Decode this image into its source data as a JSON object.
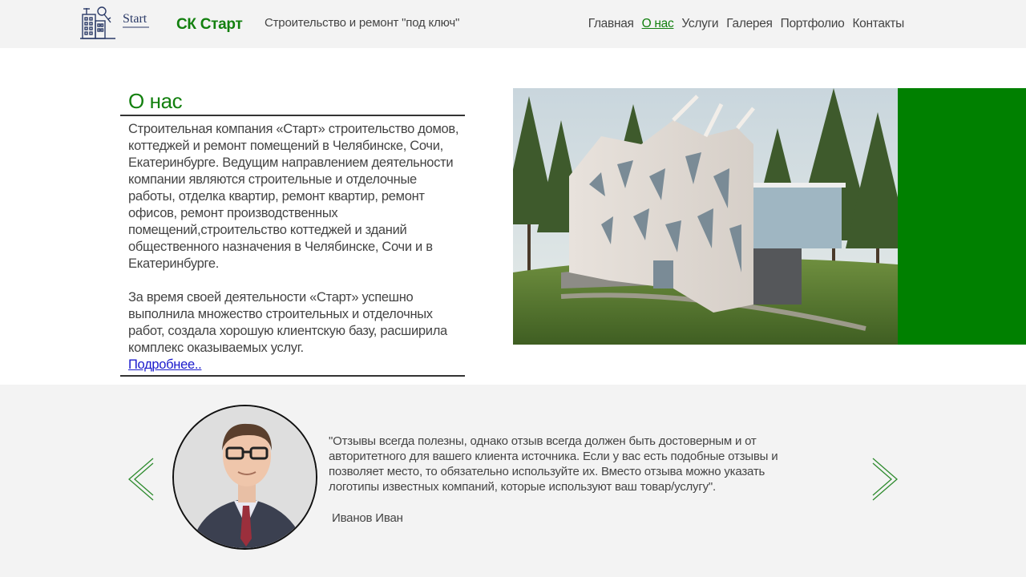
{
  "header": {
    "brand": "СК Старт",
    "tagline": "Строительство и ремонт \"под ключ\"",
    "logo_text": "Start",
    "nav": [
      {
        "label": "Главная",
        "active": false
      },
      {
        "label": "О нас",
        "active": true
      },
      {
        "label": "Услуги",
        "active": false
      },
      {
        "label": "Галерея",
        "active": false
      },
      {
        "label": "Портфолио",
        "active": false
      },
      {
        "label": "Контакты",
        "active": false
      }
    ]
  },
  "about": {
    "title": "О нас",
    "paragraph1": "Строительная компания «Старт» строительство домов, коттеджей и ремонт помещений в Челябинске, Сочи, Екатеринбурге. Ведущим направлением деятельности компании являются строительные и отделочные работы, отделка квартир, ремонт квартир, ремонт офисов, ремонт производственных помещений,строительство коттеджей и зданий общественного назначения в Челябинске, Сочи и в Екатеринбурге.",
    "paragraph2": "За время своей деятельности «Старт» успешно выполнила множество строительных и отделочных работ, создала хорошую клиентскую базу, расширила комплекс оказываемых услуг.",
    "more_link": "Подробнее.."
  },
  "review": {
    "quote": "\"Отзывы всегда полезны, однако отзыв всегда должен быть достоверным и от авторитетного для вашего клиента источника. Если у вас есть подобные отзывы и позволяет место, то обязательно используйте их. Вместо отзыва можно указать логотипы известных компаний, которые используют ваш товар/услугу\".",
    "author": "Иванов Иван"
  },
  "colors": {
    "accent_green": "#13800f",
    "panel_green": "#008000",
    "header_bg": "#f3f3f3",
    "link_blue": "#1a1acc"
  }
}
